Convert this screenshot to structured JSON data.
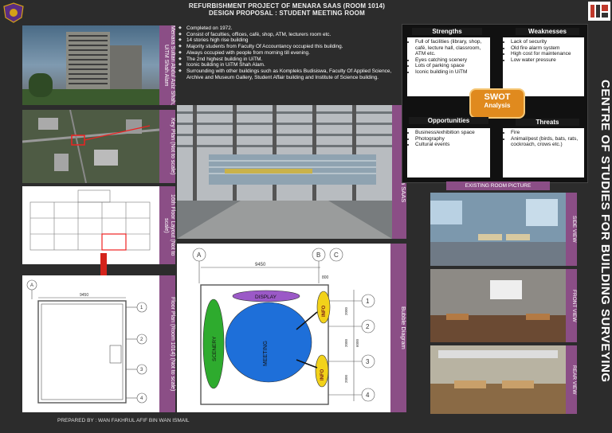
{
  "header": {
    "title_line1": "REFURBISHMENT PROJECT OF MENARA SAAS (ROOM 1014)",
    "title_line2": "DESIGN PROPOSAL : STUDENT MEETING ROOM"
  },
  "labels": {
    "building_photo": "Menara Sultan Abdul Aziz Shah, UiTM Shah Alam",
    "key_plan": "Key Plan (Not to scale)",
    "floor_layout": "16th Floor Layout (Not to scale)",
    "floor_plan": "Floor Plan (Room 1014) (Not to scale)",
    "dataran": "Dataran Menara SAAS",
    "bubble": "Bubble Diagram",
    "existing_room": "EXISTING ROOM PICTURE",
    "side_view": "SIDE VIEW",
    "front_view": "FRONT VIEW",
    "rear_view": "REAR VIEW",
    "vertical_title": "CENTRE OF STUDIES FOR BUILDING SURVEYING",
    "footer": "PREPARED BY : WAN FAKHRUL AFIF BIN WAN ISMAIL"
  },
  "bullets": [
    "Completed on 1972.",
    "Consist of faculties, offices, café, shop, ATM, lecturers room etc.",
    "14 stories high rise building",
    "Majority students from Faculty Of Accountancy occupied this building.",
    "Always occupied with people from morning till evening.",
    "The 2nd highest building in UiTM.",
    "Iconic building in UiTM Shah Alam.",
    "Surrounding with other buildings such as Kompleks Budisiswa, Faculty Of Applied Science, Archive and Museum Gallery, Student Affair building and Institute of Science building."
  ],
  "swot": {
    "center_title": "SWOT",
    "center_sub": "Analysis",
    "strengths_title": "Strengths",
    "strengths": [
      "Full of facilities (library, shop, café, lecture hall, classroom, ATM etc.",
      "Eyes catching scenery",
      "Lots of parking space",
      "Iconic building in UiTM"
    ],
    "weaknesses_title": "Weaknesses",
    "weaknesses": [
      "Lack of security",
      "Old fire alarm system",
      "High cost for maintenance",
      "Low water pressure"
    ],
    "opportunities_title": "Opportunities",
    "opportunities": [
      "Business/exhibition space",
      "Photography",
      "Cultural events"
    ],
    "threats_title": "Threats",
    "threats": [
      "Fire",
      "Animal/pest (birds, bats, rats, cockroach, crows etc.)"
    ]
  },
  "bubble_diagram": {
    "display": "DISPLAY",
    "scenery": "SCENERY",
    "meeting": "MEETING",
    "info1": "INFO",
    "info2": "INFO",
    "dim_top": "9450",
    "dim_small": "800",
    "grid_a": "A",
    "grid_b": "B",
    "grid_c": "C",
    "grid_1": "1",
    "grid_2": "2",
    "grid_3": "3",
    "grid_4": "4",
    "dim_side1": "2000",
    "dim_side2": "2000",
    "dim_side3": "2000",
    "dim_side4": "6000"
  },
  "floor_plan_drawing": {
    "grid_a": "A",
    "grid_1": "1",
    "grid_2": "2",
    "grid_3": "3",
    "grid_4": "4",
    "dim_top": "9450"
  },
  "colors": {
    "background": "#2c2c2c",
    "purple": "#8b4e86",
    "swot_orange": "#e08a1e",
    "meeting_blue": "#1e6fd9",
    "scenery_green": "#2eab2e",
    "info_yellow": "#f2d21a",
    "display_purple": "#9b59c7"
  }
}
